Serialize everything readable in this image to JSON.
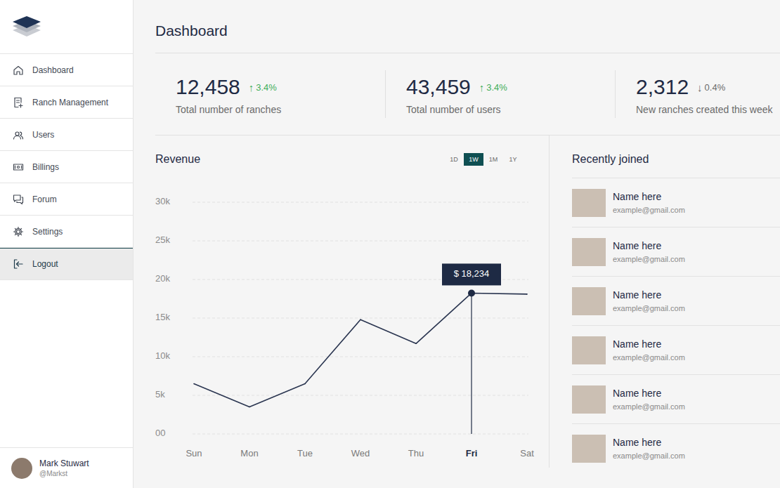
{
  "sidebar": {
    "items": [
      {
        "label": "Dashboard",
        "selected": false
      },
      {
        "label": "Ranch Management",
        "selected": false
      },
      {
        "label": "Users",
        "selected": false
      },
      {
        "label": "Billings",
        "selected": false
      },
      {
        "label": "Forum",
        "selected": false
      },
      {
        "label": "Settings",
        "selected": false
      },
      {
        "label": "Logout",
        "selected": true
      }
    ]
  },
  "user": {
    "name": "Mark Stuwart",
    "handle": "@Markst"
  },
  "page": {
    "title": "Dashboard"
  },
  "stats": [
    {
      "value": "12,458",
      "arrow": "↑",
      "change": "3.4%",
      "trend": "up",
      "label": "Total number of ranches"
    },
    {
      "value": "43,459",
      "arrow": "↑",
      "change": "3.4%",
      "trend": "up",
      "label": "Total number of users"
    },
    {
      "value": "2,312",
      "arrow": "↓",
      "change": "0.4%",
      "trend": "down",
      "label": "New ranches created this week"
    }
  ],
  "revenue": {
    "title": "Revenue",
    "ranges": [
      {
        "label": "1D",
        "selected": false
      },
      {
        "label": "1W",
        "selected": true
      },
      {
        "label": "1M",
        "selected": false
      },
      {
        "label": "1Y",
        "selected": false
      }
    ],
    "y_ticks": [
      "30k",
      "25k",
      "20k",
      "15k",
      "10k",
      "5k",
      "00"
    ],
    "x_labels": [
      {
        "label": "Sun",
        "selected": false
      },
      {
        "label": "Mon",
        "selected": false
      },
      {
        "label": "Tue",
        "selected": false
      },
      {
        "label": "Wed",
        "selected": false
      },
      {
        "label": "Thu",
        "selected": false
      },
      {
        "label": "Fri",
        "selected": true
      },
      {
        "label": "Sat",
        "selected": false
      }
    ],
    "values": [
      6500,
      3500,
      6500,
      14800,
      11700,
      18234,
      18100
    ],
    "tooltip": {
      "text": "$ 18,234"
    }
  },
  "recent": {
    "title": "Recently joined",
    "users": [
      {
        "name": "Name here",
        "email": "example@gmail.com"
      },
      {
        "name": "Name here",
        "email": "example@gmail.com"
      },
      {
        "name": "Name here",
        "email": "example@gmail.com"
      },
      {
        "name": "Name here",
        "email": "example@gmail.com"
      },
      {
        "name": "Name here",
        "email": "example@gmail.com"
      },
      {
        "name": "Name here",
        "email": "example@gmail.com"
      }
    ]
  }
}
